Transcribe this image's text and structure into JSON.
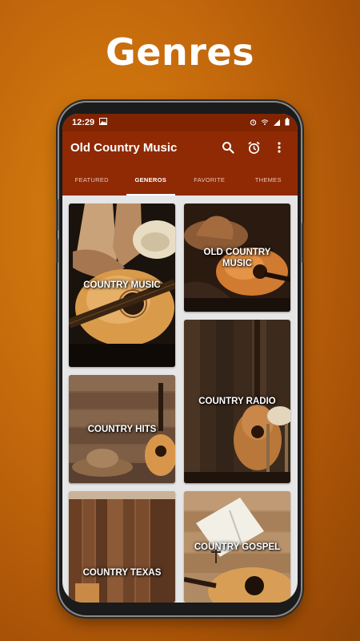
{
  "headline": "Genres",
  "status": {
    "time": "12:29"
  },
  "app": {
    "title": "Old Country Music"
  },
  "tabs": [
    {
      "label": "FEATURED"
    },
    {
      "label": "GENEROS"
    },
    {
      "label": "FAVORITE"
    },
    {
      "label": "THEMES"
    }
  ],
  "active_tab": "GENEROS",
  "genres": [
    {
      "label": "COUNTRY MUSIC"
    },
    {
      "label": "OLD COUNTRY MUSIC"
    },
    {
      "label": "COUNTRY RADIO"
    },
    {
      "label": "COUNTRY HITS"
    },
    {
      "label": "COUNTRY TEXAS"
    },
    {
      "label": "COUNTRY GOSPEL"
    }
  ],
  "colors": {
    "background": "#c4690c",
    "status_bar": "#7f2300",
    "app_bar": "#8f2a05",
    "tile_text": "#ffffff"
  },
  "icons": [
    "search-icon",
    "alarm-icon",
    "more-vert-icon"
  ]
}
